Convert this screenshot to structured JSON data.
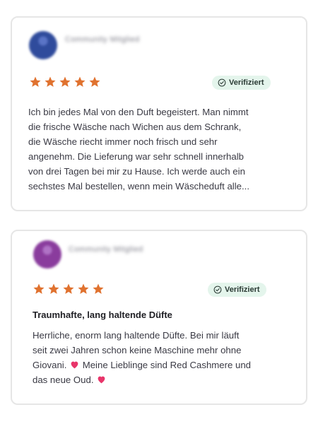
{
  "colors": {
    "star": "#e0722f",
    "verified_bg": "#e4f5ec",
    "heart": "#e8356a"
  },
  "reviews": [
    {
      "avatar_icon": "user-avatar-blurred",
      "name_blurred": "Community Mitglied",
      "rating_stars": 5,
      "verified_label": "Verifiziert",
      "title": "",
      "text": [
        "Ich bin jedes Mal von den Duft begeistert. Man nimmt",
        "die frische Wäsche nach Wichen aus dem Schrank,",
        "die Wäsche riecht immer noch frisch und sehr",
        "angenehm. Die Lieferung war sehr schnell innerhalb",
        "von drei Tagen bei mir zu Hause. Ich werde auch ein",
        "sechstes Mal bestellen, wenn mein Wäscheduft alle..."
      ]
    },
    {
      "avatar_icon": "user-avatar-blurred",
      "name_blurred": "Community Mitglied",
      "rating_stars": 5,
      "verified_label": "Verifiziert",
      "title": "Traumhafte, lang haltende Düfte",
      "text_parts": {
        "line1": "Herrliche, enorm lang haltende Düfte. Bei mir läuft",
        "line2": "seit zwei Jahren schon keine Maschine mehr ohne",
        "line3a": "Giovani.",
        "line3b": "Meine Lieblinge sind Red Cashmere und",
        "line4": "das neue Oud."
      }
    }
  ]
}
